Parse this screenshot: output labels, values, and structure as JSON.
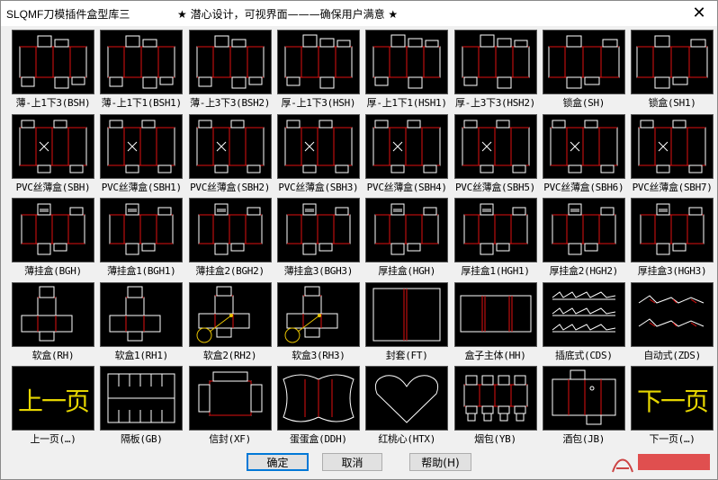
{
  "window": {
    "title": "SLQMF刀模插件盒型库三",
    "slogan": "★ 潜心设计，可视界面———确保用户满意 ★",
    "close_symbol": "✕"
  },
  "colors": {
    "thumb_bg": "#000000",
    "line": "#ffffff",
    "accent": "#e01010",
    "yellow_text": "#e6d600"
  },
  "rows": [
    [
      {
        "label": "薄-上1下3(BSH)",
        "icon": "tuck-box-thin"
      },
      {
        "label": "薄-上1下1(BSH1)",
        "icon": "tuck-box-thin"
      },
      {
        "label": "薄-上3下3(BSH2)",
        "icon": "tuck-box-thin"
      },
      {
        "label": "厚-上1下3(HSH)",
        "icon": "tuck-box-thick"
      },
      {
        "label": "厚-上1下1(HSH1)",
        "icon": "tuck-box-thick"
      },
      {
        "label": "厚-上3下3(HSH2)",
        "icon": "tuck-box-thick"
      },
      {
        "label": "锁盒(SH)",
        "icon": "lock-box"
      },
      {
        "label": "锁盒(SH1)",
        "icon": "lock-box"
      }
    ],
    [
      {
        "label": "PVC丝薄盒(SBH)",
        "icon": "pvc-box"
      },
      {
        "label": "PVC丝薄盒(SBH1)",
        "icon": "pvc-box"
      },
      {
        "label": "PVC丝薄盒(SBH2)",
        "icon": "pvc-box"
      },
      {
        "label": "PVC丝薄盒(SBH3)",
        "icon": "pvc-box"
      },
      {
        "label": "PVC丝薄盒(SBH4)",
        "icon": "pvc-box"
      },
      {
        "label": "PVC丝薄盒(SBH5)",
        "icon": "pvc-box"
      },
      {
        "label": "PVC丝薄盒(SBH6)",
        "icon": "pvc-box"
      },
      {
        "label": "PVC丝薄盒(SBH7)",
        "icon": "pvc-box"
      }
    ],
    [
      {
        "label": "薄挂盒(BGH)",
        "icon": "hang-box"
      },
      {
        "label": "薄挂盒1(BGH1)",
        "icon": "hang-box"
      },
      {
        "label": "薄挂盒2(BGH2)",
        "icon": "hang-box"
      },
      {
        "label": "薄挂盒3(BGH3)",
        "icon": "hang-box"
      },
      {
        "label": "厚挂盒(HGH)",
        "icon": "hang-box"
      },
      {
        "label": "厚挂盒1(HGH1)",
        "icon": "hang-box"
      },
      {
        "label": "厚挂盒2(HGH2)",
        "icon": "hang-box"
      },
      {
        "label": "厚挂盒3(HGH3)",
        "icon": "hang-box"
      }
    ],
    [
      {
        "label": "软盒(RH)",
        "icon": "soft-box"
      },
      {
        "label": "软盒1(RH1)",
        "icon": "soft-box"
      },
      {
        "label": "软盒2(RH2)",
        "icon": "soft-box-detail"
      },
      {
        "label": "软盒3(RH3)",
        "icon": "soft-box-detail"
      },
      {
        "label": "封套(FT)",
        "icon": "sleeve"
      },
      {
        "label": "盒子主体(HH)",
        "icon": "box-body"
      },
      {
        "label": "插底式(CDS)",
        "icon": "insert-bottom"
      },
      {
        "label": "自动式(ZDS)",
        "icon": "auto-bottom"
      }
    ],
    [
      {
        "label": "上一页(…)",
        "icon": "prev-page",
        "big_text": "上一页"
      },
      {
        "label": "隔板(GB)",
        "icon": "divider"
      },
      {
        "label": "信封(XF)",
        "icon": "envelope"
      },
      {
        "label": "蛋蛋盒(DDH)",
        "icon": "egg-box"
      },
      {
        "label": "红桃心(HTX)",
        "icon": "heart"
      },
      {
        "label": "烟包(YB)",
        "icon": "cigarette-pack"
      },
      {
        "label": "酒包(JB)",
        "icon": "wine-pack"
      },
      {
        "label": "下一页(…)",
        "icon": "next-page",
        "big_text": "下一页"
      }
    ]
  ],
  "buttons": {
    "ok": "确定",
    "cancel": "取消",
    "help": "帮助(H)"
  }
}
